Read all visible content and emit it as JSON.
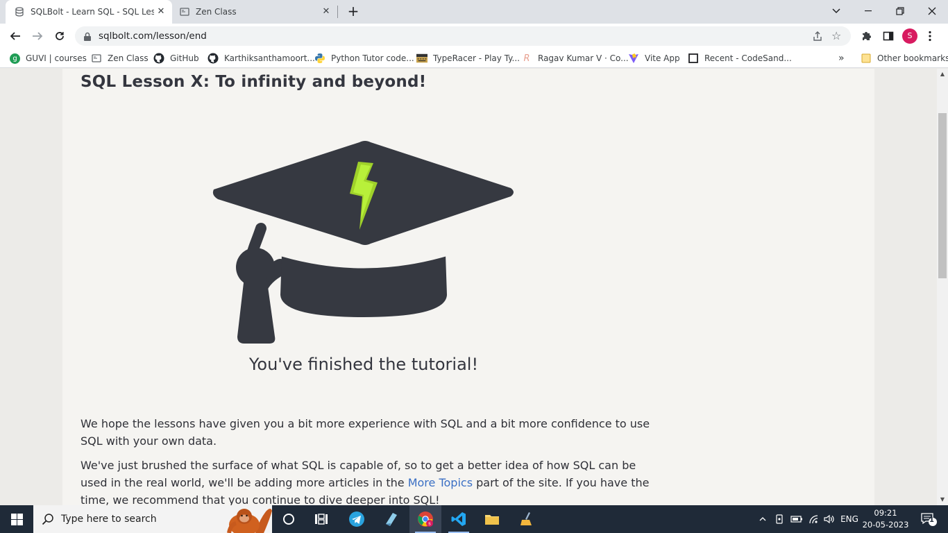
{
  "browser": {
    "tabs": [
      {
        "title": "SQLBolt - Learn SQL - SQL Lesson X: To infinity and beyond!",
        "active": true
      },
      {
        "title": "Zen Class",
        "active": false
      }
    ],
    "new_tab_label": "+",
    "url": "sqlbolt.com/lesson/end",
    "profile_initial": "S",
    "bookmarks": [
      {
        "label": "GUVI | courses",
        "icon": "guvi-icon"
      },
      {
        "label": "Zen Class",
        "icon": "zen-class-icon"
      },
      {
        "label": "GitHub",
        "icon": "github-icon"
      },
      {
        "label": "Karthiksanthamoort...",
        "icon": "github-icon"
      },
      {
        "label": "Python Tutor code...",
        "icon": "python-icon"
      },
      {
        "label": "TypeRacer - Play Ty...",
        "icon": "typeracer-icon"
      },
      {
        "label": "Ragav Kumar V · Co...",
        "icon": "codepen-icon"
      },
      {
        "label": "Vite App",
        "icon": "vite-icon"
      },
      {
        "label": "Recent - CodeSand...",
        "icon": "codesandbox-icon"
      }
    ],
    "more_bookmarks_label": "»",
    "other_bookmarks_label": "Other bookmarks"
  },
  "page": {
    "lesson_title": "SQL Lesson X: To infinity and beyond!",
    "finished_text": "You've finished the tutorial!",
    "para1": "We hope the lessons have given you a bit more experience with SQL and a bit more confidence to use SQL with your own data.",
    "para2_before": "We've just brushed the surface of what SQL is capable of, so to get a better idea of how SQL can be used in the real world, we'll be adding more articles in the ",
    "para2_link": "More Topics",
    "para2_after": " part of the site. If you have the time, we recommend that you continue to dive deeper into SQL!"
  },
  "taskbar": {
    "search_placeholder": "Type here to search",
    "language": "ENG",
    "time": "09:21",
    "date": "20-05-2023",
    "notification_count": "1"
  },
  "colors": {
    "cap": "#363941",
    "bolt": "#a6e22e",
    "link": "#3a6fc4",
    "taskbar": "#1f2a38"
  }
}
